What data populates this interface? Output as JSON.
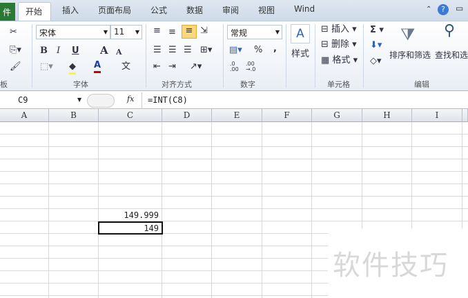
{
  "tabs": {
    "file": "件",
    "items": [
      "开始",
      "插入",
      "页面布局",
      "公式",
      "数据",
      "审阅",
      "视图",
      "Wind"
    ]
  },
  "ribbon": {
    "font_name": "宋体",
    "font_size": "11",
    "number_format": "常规",
    "groups": {
      "clipboard": "板",
      "font": "字体",
      "alignment": "对齐方式",
      "number": "数字",
      "cells": "单元格",
      "editing": "编辑"
    },
    "styles": "样式",
    "insert": "插入",
    "delete": "删除",
    "format": "格式",
    "sort_filter": "排序和筛选",
    "find_select": "查找和选",
    "percent": "%",
    "comma": ",",
    "bold": "B",
    "italic": "I",
    "underline": "U",
    "grow": "A",
    "shrink": "A",
    "font_color": "A",
    "phonetic": "文",
    "sigma": "Σ",
    "inc_dec": ".0\n.00",
    "dec_dec": ".00\n→.0"
  },
  "formula_bar": {
    "name_box": "C9",
    "fx": "fx",
    "formula": "=INT(C8)"
  },
  "columns": [
    "A",
    "B",
    "C",
    "D",
    "E",
    "F",
    "G",
    "H",
    "I"
  ],
  "cells": {
    "C8": "149.999",
    "C9": "149"
  },
  "watermark": "软件技巧"
}
